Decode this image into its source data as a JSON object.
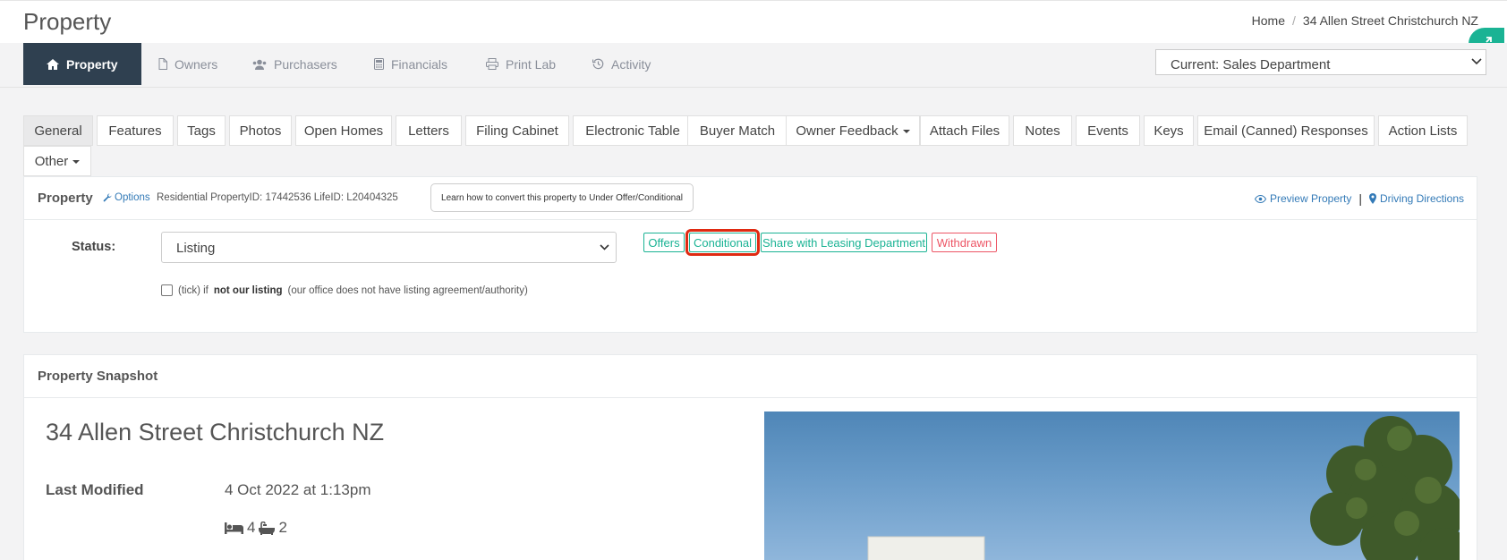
{
  "header": {
    "title": "Property",
    "breadcrumb": {
      "home": "Home",
      "separator": "/",
      "current": "34 Allen Street Christchurch NZ"
    }
  },
  "nav": {
    "items": [
      {
        "label": "Property",
        "icon": "home-icon",
        "active": true
      },
      {
        "label": "Owners",
        "icon": "file-icon"
      },
      {
        "label": "Purchasers",
        "icon": "users-icon"
      },
      {
        "label": "Financials",
        "icon": "calculator-icon"
      },
      {
        "label": "Print Lab",
        "icon": "print-icon"
      },
      {
        "label": "Activity",
        "icon": "history-icon"
      }
    ],
    "department": "Current: Sales Department"
  },
  "tabs": [
    {
      "label": "General",
      "active": true
    },
    {
      "label": "Features"
    },
    {
      "label": "Tags"
    },
    {
      "label": "Photos"
    },
    {
      "label": "Open Homes"
    },
    {
      "label": "Letters"
    },
    {
      "label": "Filing Cabinet"
    },
    {
      "label": "Electronic Table"
    },
    {
      "label": "Buyer Match"
    },
    {
      "label": "Owner Feedback",
      "dropdown": true
    },
    {
      "label": "Attach Files"
    },
    {
      "label": "Notes"
    },
    {
      "label": "Events"
    },
    {
      "label": "Keys"
    },
    {
      "label": "Email (Canned) Responses"
    },
    {
      "label": "Action Lists"
    },
    {
      "label": "Other",
      "dropdown": true
    }
  ],
  "property_panel": {
    "title": "Property",
    "options_label": "Options",
    "ids_text": "Residential PropertyID: 17442536 LifeID: L20404325",
    "learn_button": "Learn how to convert this property to Under Offer/Conditional",
    "preview_link": "Preview Property",
    "divider": "|",
    "directions_link": "Driving Directions",
    "status_label": "Status:",
    "status_value": "Listing",
    "status_buttons": [
      {
        "label": "Offers",
        "style": "success"
      },
      {
        "label": "Conditional",
        "style": "success",
        "highlighted": true
      },
      {
        "label": "Share with Leasing Department",
        "style": "success"
      },
      {
        "label": "Withdrawn",
        "style": "danger"
      }
    ],
    "tick": {
      "prefix": "(tick) if",
      "bold": "not our listing",
      "suffix": "(our office does not have listing agreement/authority)"
    }
  },
  "snapshot": {
    "title": "Property Snapshot",
    "address": "34 Allen Street Christchurch NZ",
    "last_modified_label": "Last Modified",
    "last_modified_value": "4 Oct 2022 at 1:13pm",
    "bedrooms": "4",
    "bathrooms": "2"
  },
  "colors": {
    "accent": "#1ab394",
    "danger": "#ed5565",
    "navy": "#2f4050",
    "link": "#337ab7",
    "highlight": "#e02a12"
  }
}
